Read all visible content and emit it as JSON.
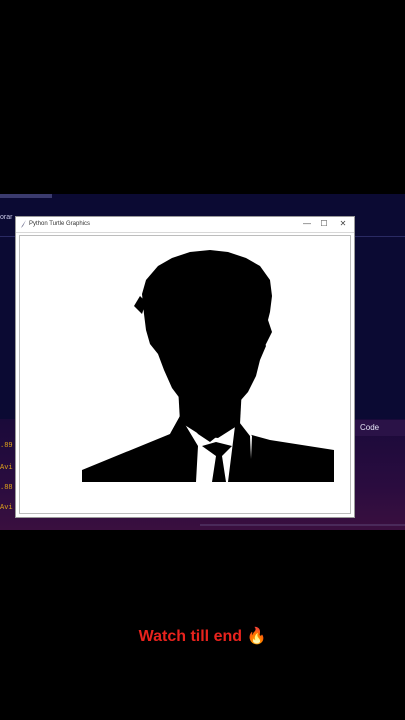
{
  "window": {
    "title": "Python Turtle Graphics",
    "minimize_glyph": "—",
    "maximize_glyph": "☐",
    "close_glyph": "✕"
  },
  "ide": {
    "left_tab_text": "orar",
    "panel_tab": "Code",
    "output_lines": [
      ".89",
      "Avi",
      ".88",
      "Avi"
    ]
  },
  "caption": {
    "text": "Watch till end",
    "emoji": "🔥"
  },
  "colors": {
    "caption": "#e8231d",
    "ide_bg": "#0b0a33",
    "output_text": "#e0a31a"
  },
  "drawing": {
    "subject": "man-silhouette-in-suit-and-tie"
  }
}
